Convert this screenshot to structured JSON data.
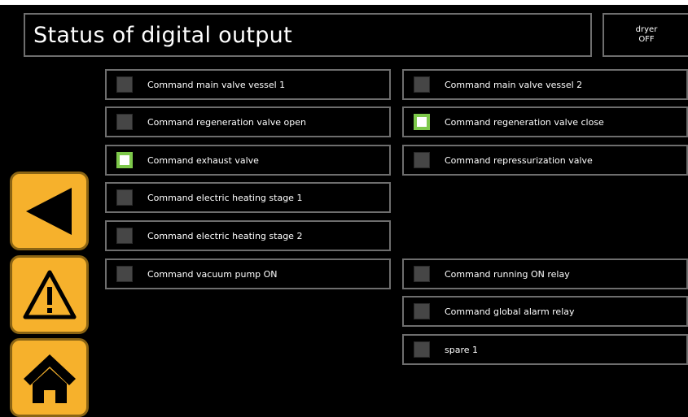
{
  "header": {
    "title": "Status of digital output",
    "status_line1": "dryer",
    "status_line2": "OFF"
  },
  "outputs_left": [
    {
      "label": "Command main valve vessel 1",
      "on": false
    },
    {
      "label": "Command regeneration valve open",
      "on": false
    },
    {
      "label": "Command exhaust valve",
      "on": true
    },
    {
      "label": "Command electric heating stage 1",
      "on": false
    },
    {
      "label": "Command electric heating stage 2",
      "on": false
    },
    {
      "label": "Command vacuum pump ON",
      "on": false
    }
  ],
  "outputs_right": [
    {
      "label": "Command main valve vessel 2",
      "on": false
    },
    {
      "label": "Command regeneration valve close",
      "on": true
    },
    {
      "label": "Command repressurization valve",
      "on": false
    },
    {
      "label": "Command running ON relay",
      "on": false
    },
    {
      "label": "Command global alarm relay",
      "on": false
    },
    {
      "label": "spare 1",
      "on": false
    }
  ],
  "nav": {
    "buttons": [
      "back-arrow-icon",
      "warning-icon",
      "home-icon"
    ],
    "accent_color": "#f6b12c"
  },
  "colors": {
    "background": "#000000",
    "led_off": "#464646",
    "led_on": "#7dc84a",
    "border": "#6e6e6e"
  }
}
